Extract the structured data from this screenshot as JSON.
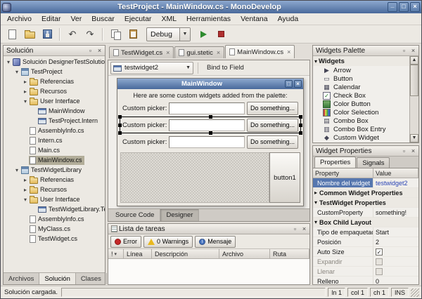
{
  "titlebar": {
    "title": "TestProject - MainWindow.cs - MonoDevelop"
  },
  "menubar": {
    "items": [
      "Archivo",
      "Editar",
      "Ver",
      "Buscar",
      "Ejecutar",
      "XML",
      "Herramientas",
      "Ventana",
      "Ayuda"
    ]
  },
  "toolbar": {
    "debug_label": "Debug",
    "left_icons": [
      "new-file",
      "open",
      "save",
      "sep",
      "undo",
      "redo",
      "sep",
      "copy",
      "paste"
    ],
    "right_icons": [
      "run",
      "stop"
    ]
  },
  "solution_panel": {
    "title": "Solución",
    "tree": [
      {
        "level": 0,
        "expander": "expanded",
        "icon": "solution",
        "label": "Solución DesignerTestSolution"
      },
      {
        "level": 1,
        "expander": "expanded",
        "icon": "project",
        "label": "TestProject"
      },
      {
        "level": 2,
        "expander": "collapsed",
        "icon": "folder",
        "label": "Referencias"
      },
      {
        "level": 2,
        "expander": "collapsed",
        "icon": "folder",
        "label": "Recursos"
      },
      {
        "level": 2,
        "expander": "expanded",
        "icon": "folder",
        "label": "User Interface"
      },
      {
        "level": 3,
        "expander": "none",
        "icon": "window",
        "label": "MainWindow"
      },
      {
        "level": 3,
        "expander": "none",
        "icon": "window",
        "label": "TestProject.Intern"
      },
      {
        "level": 2,
        "expander": "none",
        "icon": "file",
        "label": "AssemblyInfo.cs"
      },
      {
        "level": 2,
        "expander": "none",
        "icon": "file",
        "label": "Intern.cs"
      },
      {
        "level": 2,
        "expander": "none",
        "icon": "file",
        "label": "Main.cs"
      },
      {
        "level": 2,
        "expander": "none",
        "icon": "file",
        "label": "MainWindow.cs",
        "selected": true
      },
      {
        "level": 1,
        "expander": "expanded",
        "icon": "project",
        "label": "TestWidgetLibrary"
      },
      {
        "level": 2,
        "expander": "collapsed",
        "icon": "folder",
        "label": "Referencias"
      },
      {
        "level": 2,
        "expander": "collapsed",
        "icon": "folder",
        "label": "Recursos"
      },
      {
        "level": 2,
        "expander": "expanded",
        "icon": "folder",
        "label": "User Interface"
      },
      {
        "level": 3,
        "expander": "none",
        "icon": "window",
        "label": "TestWidgetLibrary.Tes"
      },
      {
        "level": 2,
        "expander": "none",
        "icon": "file",
        "label": "AssemblyInfo.cs"
      },
      {
        "level": 2,
        "expander": "none",
        "icon": "file",
        "label": "MyClass.cs"
      },
      {
        "level": 2,
        "expander": "none",
        "icon": "file",
        "label": "TestWidget.cs"
      }
    ],
    "tabs": [
      {
        "label": "Archivos",
        "active": false
      },
      {
        "label": "Solución",
        "active": true
      },
      {
        "label": "Clases",
        "active": false
      }
    ]
  },
  "editor": {
    "tabs": [
      {
        "label": "TestWidget.cs",
        "active": false
      },
      {
        "label": "gui.stetic",
        "active": false
      },
      {
        "label": "MainWindow.cs",
        "active": true
      }
    ],
    "widget_combo": "testwidget2",
    "bind_button": "Bind to Field",
    "view_tabs": [
      {
        "label": "Source Code",
        "active": false
      },
      {
        "label": "Designer",
        "active": true
      }
    ]
  },
  "designer": {
    "window_title": "MainWindow",
    "intro_text": "Here are some custom widgets added from the palette:",
    "rows": [
      {
        "label": "Custom picker:",
        "value": "",
        "button": "Do something...",
        "selected": false
      },
      {
        "label": "Custom picker:",
        "value": "",
        "button": "Do something...",
        "selected": true
      },
      {
        "label": "Custom picker:",
        "value": "",
        "button": "Do something...",
        "selected": false
      }
    ],
    "button1_label": "button1"
  },
  "task_panel": {
    "title": "Lista de tareas",
    "buttons": [
      {
        "label": "Error",
        "icon": "error"
      },
      {
        "label": "0 Warnings",
        "icon": "warning"
      },
      {
        "label": "Mensaje",
        "icon": "message"
      }
    ],
    "columns": [
      "!",
      "Línea",
      "Descripción",
      "Archivo",
      "Ruta"
    ]
  },
  "palette_panel": {
    "title": "Widgets Palette",
    "section": "Widgets",
    "items": [
      {
        "label": "Arrow",
        "icon": "arrow"
      },
      {
        "label": "Button",
        "icon": "button"
      },
      {
        "label": "Calendar",
        "icon": "calendar"
      },
      {
        "label": "Check Box",
        "icon": "checkbox"
      },
      {
        "label": "Color Button",
        "icon": "color-button"
      },
      {
        "label": "Color Selection",
        "icon": "color-selection"
      },
      {
        "label": "Combo Box",
        "icon": "combobox"
      },
      {
        "label": "Combo Box Entry",
        "icon": "combobox-entry"
      },
      {
        "label": "Custom Widget",
        "icon": "custom-widget"
      }
    ]
  },
  "properties_panel": {
    "title": "Widget Properties",
    "tabs": [
      {
        "label": "Properties",
        "active": true
      },
      {
        "label": "Signals",
        "active": false
      }
    ],
    "columns": [
      "Property",
      "Value"
    ],
    "rows": [
      {
        "type": "prop",
        "name": "Nombre del widget",
        "value": "testwidget2",
        "selected": true,
        "value_color": "blue"
      },
      {
        "type": "section",
        "name": "Common Widget Properties",
        "expanded": false
      },
      {
        "type": "section",
        "name": "TestWidget Properties",
        "expanded": true
      },
      {
        "type": "prop",
        "name": "CustomProperty",
        "value": "something!"
      },
      {
        "type": "section",
        "name": "Box Child Layout",
        "expanded": true
      },
      {
        "type": "prop",
        "name": "Tipo de empaquetado",
        "value": "Start"
      },
      {
        "type": "prop",
        "name": "Posición",
        "value": "2"
      },
      {
        "type": "check",
        "name": "Auto Size",
        "checked": true
      },
      {
        "type": "check",
        "name": "Expandir",
        "checked": false,
        "disabled": true
      },
      {
        "type": "check",
        "name": "Llenar",
        "checked": false,
        "disabled": true
      },
      {
        "type": "prop",
        "name": "Relleno",
        "value": "0"
      }
    ]
  },
  "statusbar": {
    "message": "Solución cargada.",
    "line": "ln 1",
    "col": "col 1",
    "ch": "ch 1",
    "mode": "INS"
  },
  "colors": {
    "titlebar_top": "#8ea9cf",
    "titlebar_bottom": "#49699b",
    "selection": "#5677af",
    "tree_selection": "#b2ad99",
    "value_blue": "#2a44b4",
    "error_red": "#c42828",
    "warning_yellow": "#e8b81e",
    "info_blue": "#4a76c0"
  }
}
